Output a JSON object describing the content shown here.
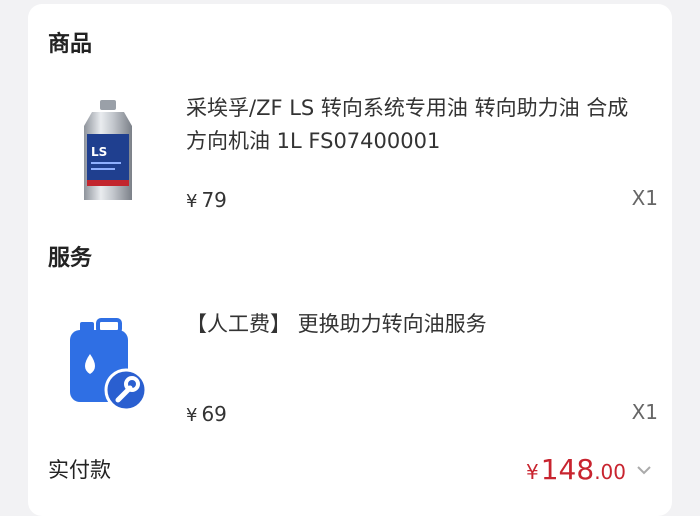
{
  "sections": {
    "goods_title": "商品",
    "service_title": "服务"
  },
  "goods": {
    "image_icon": "ls-oil-bottle-image",
    "title": "采埃孚/ZF LS 转向系统专用油 转向助力油 合成方向机油 1L FS07400001",
    "currency": "¥",
    "price": "79",
    "quantity": "X1"
  },
  "service": {
    "image_icon": "fluid-canister-wrench-icon",
    "title": "【人工费】 更换助力转向油服务",
    "currency": "¥",
    "price": "69",
    "quantity": "X1"
  },
  "total": {
    "label": "实付款",
    "currency": "¥",
    "integer": "148",
    "decimal": ".00",
    "expand_icon": "chevron-down-icon"
  },
  "colors": {
    "price_red": "#c8242f",
    "icon_blue": "#2f6fe4",
    "background": "#f2f2f4"
  }
}
